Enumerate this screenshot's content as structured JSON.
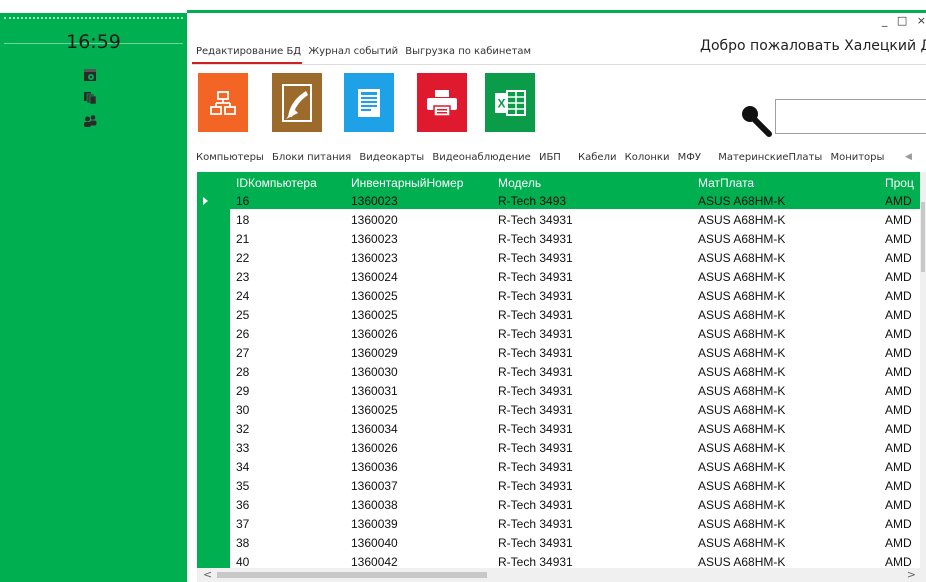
{
  "sidebar": {
    "clock": "16:59",
    "icons": [
      "settings-calendar-icon",
      "documents-icon",
      "users-icon"
    ]
  },
  "window": {
    "minimize": "_",
    "maximize": "□",
    "close": "×"
  },
  "menu": {
    "items": [
      "Редактирование БД",
      "Журнал событий",
      "Выгрузка по кабинетам"
    ],
    "active_index": 0
  },
  "welcome": "Добро пожаловать Халецкий Д.М",
  "toolbar": {
    "tiles": [
      {
        "icon": "database-structure-icon",
        "color": "#f26524"
      },
      {
        "icon": "cleanup-icon",
        "color": "#9c6b2b"
      },
      {
        "icon": "document-icon",
        "color": "#1ea1e6"
      },
      {
        "icon": "printer-icon",
        "color": "#e01a2e"
      },
      {
        "icon": "excel-icon",
        "color": "#0b9c4a"
      }
    ]
  },
  "search": {
    "icon": "search-icon",
    "value": ""
  },
  "tabs": [
    "Компьютеры",
    "Блоки питания",
    "Видеокарты",
    "Видеонаблюдение",
    "ИБП",
    "Кабели",
    "Колонки",
    "МФУ",
    "МатеринскиеПлаты",
    "Мониторы"
  ],
  "grid": {
    "columns": [
      "IDКомпьютера",
      "ИнвентарныйНомер",
      "Модель",
      "МатПлата",
      "Проц"
    ],
    "selected_row": 0,
    "rows": [
      [
        "16",
        "1360023",
        "R-Tech 3493",
        "ASUS A68HM-K",
        "AMD"
      ],
      [
        "18",
        "1360020",
        "R-Tech 34931",
        "ASUS A68HM-K",
        "AMD"
      ],
      [
        "21",
        "1360023",
        "R-Tech 34931",
        "ASUS A68HM-K",
        "AMD"
      ],
      [
        "22",
        "1360023",
        "R-Tech 34931",
        "ASUS A68HM-K",
        "AMD"
      ],
      [
        "23",
        "1360024",
        "R-Tech 34931",
        "ASUS A68HM-K",
        "AMD"
      ],
      [
        "24",
        "1360025",
        "R-Tech 34931",
        "ASUS A68HM-K",
        "AMD"
      ],
      [
        "25",
        "1360025",
        "R-Tech 34931",
        "ASUS A68HM-K",
        "AMD"
      ],
      [
        "26",
        "1360026",
        "R-Tech 34931",
        "ASUS A68HM-K",
        "AMD"
      ],
      [
        "27",
        "1360029",
        "R-Tech 34931",
        "ASUS A68HM-K",
        "AMD"
      ],
      [
        "28",
        "1360030",
        "R-Tech 34931",
        "ASUS A68HM-K",
        "AMD"
      ],
      [
        "29",
        "1360031",
        "R-Tech 34931",
        "ASUS A68HM-K",
        "AMD"
      ],
      [
        "30",
        "1360025",
        "R-Tech 34931",
        "ASUS A68HM-K",
        "AMD"
      ],
      [
        "32",
        "1360034",
        "R-Tech 34931",
        "ASUS A68HM-K",
        "AMD"
      ],
      [
        "33",
        "1360026",
        "R-Tech 34931",
        "ASUS A68HM-K",
        "AMD"
      ],
      [
        "34",
        "1360036",
        "R-Tech 34931",
        "ASUS A68HM-K",
        "AMD"
      ],
      [
        "35",
        "1360037",
        "R-Tech 34931",
        "ASUS A68HM-K",
        "AMD"
      ],
      [
        "36",
        "1360038",
        "R-Tech 34931",
        "ASUS A68HM-K",
        "AMD"
      ],
      [
        "37",
        "1360039",
        "R-Tech 34931",
        "ASUS A68HM-K",
        "AMD"
      ],
      [
        "38",
        "1360040",
        "R-Tech 34931",
        "ASUS A68HM-K",
        "AMD"
      ],
      [
        "40",
        "1360042",
        "R-Tech 34931",
        "ASUS A68HM-K",
        "AMD"
      ]
    ]
  },
  "scroll": {
    "left_arrow": "<",
    "right_arrow": ">",
    "tab_arrow": "◀"
  }
}
